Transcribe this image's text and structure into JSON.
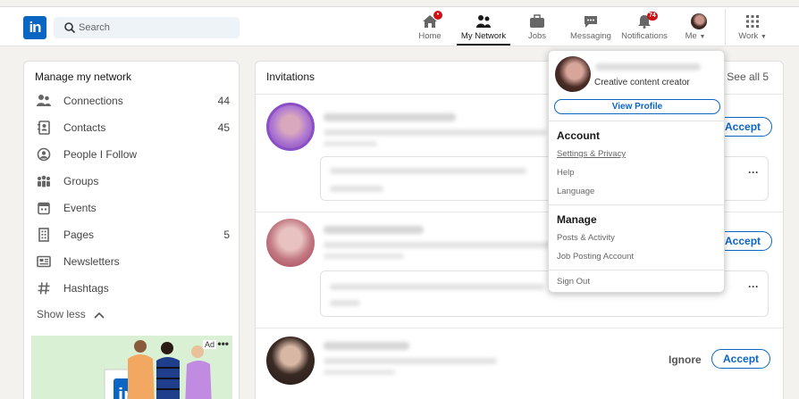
{
  "search": {
    "placeholder": "Search"
  },
  "nav": {
    "items": [
      {
        "label": "Home",
        "icon": "home-icon"
      },
      {
        "label": "My Network",
        "icon": "network-icon"
      },
      {
        "label": "Jobs",
        "icon": "briefcase-icon"
      },
      {
        "label": "Messaging",
        "icon": "chat-icon"
      },
      {
        "label": "Notifications",
        "icon": "bell-icon",
        "badge": "74"
      },
      {
        "label": "Me",
        "icon": "avatar"
      },
      {
        "label": "Work",
        "icon": "grid-icon"
      }
    ]
  },
  "left": {
    "title": "Manage my network",
    "items": [
      {
        "label": "Connections",
        "count": "44",
        "icon": "people-icon"
      },
      {
        "label": "Contacts",
        "count": "45",
        "icon": "contact-book-icon"
      },
      {
        "label": "People I Follow",
        "count": "",
        "icon": "follow-icon"
      },
      {
        "label": "Groups",
        "count": "",
        "icon": "groups-icon"
      },
      {
        "label": "Events",
        "count": "",
        "icon": "calendar-icon"
      },
      {
        "label": "Pages",
        "count": "5",
        "icon": "building-icon"
      },
      {
        "label": "Newsletters",
        "count": "",
        "icon": "newspaper-icon"
      },
      {
        "label": "Hashtags",
        "count": "",
        "icon": "hashtag-icon"
      }
    ],
    "show_less": "Show less",
    "ad_label": "Ad"
  },
  "invitations": {
    "title": "Invitations",
    "see_all": "See all 5",
    "accept": "Accept",
    "ignore": "Ignore"
  },
  "dropdown": {
    "headline": "Creative content creator",
    "view_profile": "View Profile",
    "account_heading": "Account",
    "account_links": [
      "Settings & Privacy",
      "Help",
      "Language"
    ],
    "manage_heading": "Manage",
    "manage_links": [
      "Posts & Activity",
      "Job Posting Account"
    ],
    "sign_out": "Sign Out"
  },
  "colors": {
    "brand": "#0a66c2",
    "badge": "#cc1016"
  }
}
